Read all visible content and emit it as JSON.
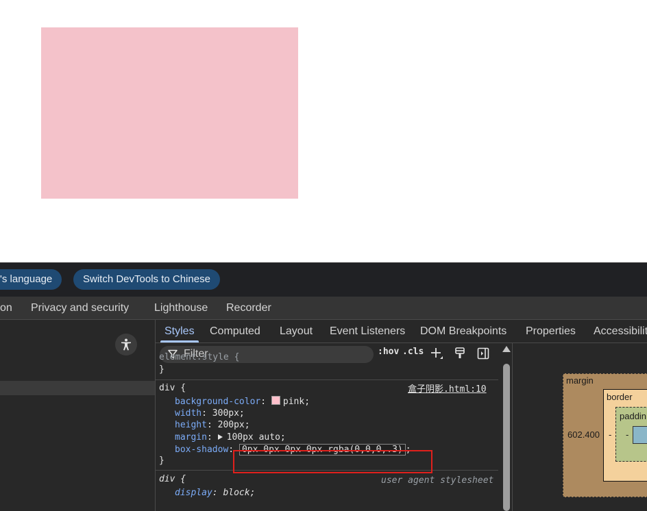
{
  "lang_bar": {
    "pill_language": "'s language",
    "pill_switch": "Switch DevTools to Chinese"
  },
  "main_tabs": [
    "on",
    "Privacy and security",
    "Lighthouse",
    "Recorder"
  ],
  "sub_tabs": [
    "Styles",
    "Computed",
    "Layout",
    "Event Listeners",
    "DOM Breakpoints",
    "Properties",
    "Accessibilit"
  ],
  "toolbar": {
    "filter_placeholder": "Filter",
    "hov": ":hov",
    "cls": ".cls"
  },
  "rules": {
    "element_style": {
      "selector": "element.style {",
      "close": "}"
    },
    "div_rule": {
      "selector": "div {",
      "source": "盒子阴影.html:10",
      "background_color_name": "background-color",
      "background_color_value": "pink;",
      "width_name": "width",
      "width_value": "300px;",
      "height_name": "height",
      "height_value": "200px;",
      "margin_name": "margin",
      "margin_value": "100px auto;",
      "box_shadow_name": "box-shadow",
      "box_shadow_value": "0px 0px 0px 0px rgba(0,0,0,.3)",
      "close": "}"
    },
    "ua_rule": {
      "selector": "div {",
      "source": "user agent stylesheet",
      "display_name": "display",
      "display_value": "block;"
    }
  },
  "box_model": {
    "margin_label": "margin",
    "border_label": "border",
    "padding_label": "paddin",
    "margin_left_value": "602.400",
    "border_left_value": "-",
    "padding_left_value": "-"
  },
  "colors": {
    "pink_box": "#f4c2ca",
    "accent": "#a8c7fa",
    "highlight": "#e0201c"
  }
}
